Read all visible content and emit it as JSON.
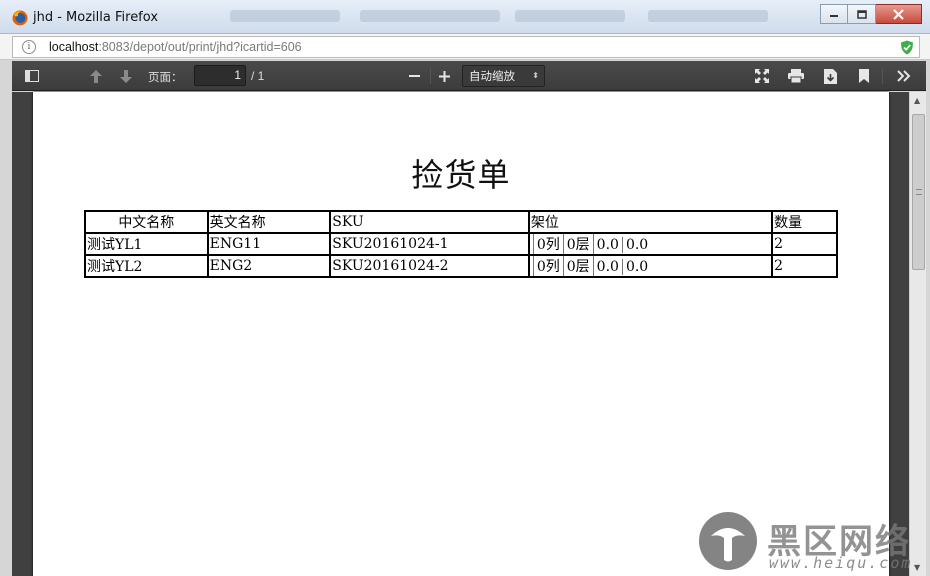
{
  "window": {
    "title": "jhd - Mozilla Firefox",
    "minimize_icon": "minimize-icon",
    "maximize_icon": "maximize-icon",
    "close_icon": "close-icon"
  },
  "urlbar": {
    "host": "localhost",
    "path": ":8083/depot/out/print/jhd?icartid=606"
  },
  "pdf_toolbar": {
    "page_label": "页面：",
    "page_number": "1",
    "page_count": "/ 1",
    "zoom_value": "自动缩放",
    "zoom_arrow": "⬍"
  },
  "document": {
    "title": "捡货单",
    "columns": [
      "中文名称",
      "英文名称",
      "SKU",
      "架位",
      "数量"
    ],
    "rows": [
      {
        "cn_name": "测试YL1",
        "en_name": "ENG11",
        "sku": "SKU20161024-1",
        "loc": [
          "0列",
          "0层",
          "0.0",
          "0.0"
        ],
        "qty": "2"
      },
      {
        "cn_name": "测试YL2",
        "en_name": "ENG2",
        "sku": "SKU20161024-2",
        "loc": [
          "0列",
          "0层",
          "0.0",
          "0.0"
        ],
        "qty": "2"
      }
    ]
  },
  "watermark": {
    "cn": "黑区网络",
    "en": "www.heiqu.com"
  },
  "colors": {
    "toolbar": "#3c3c3c",
    "viewer_bg": "#404040",
    "shield": "#3fae49"
  }
}
